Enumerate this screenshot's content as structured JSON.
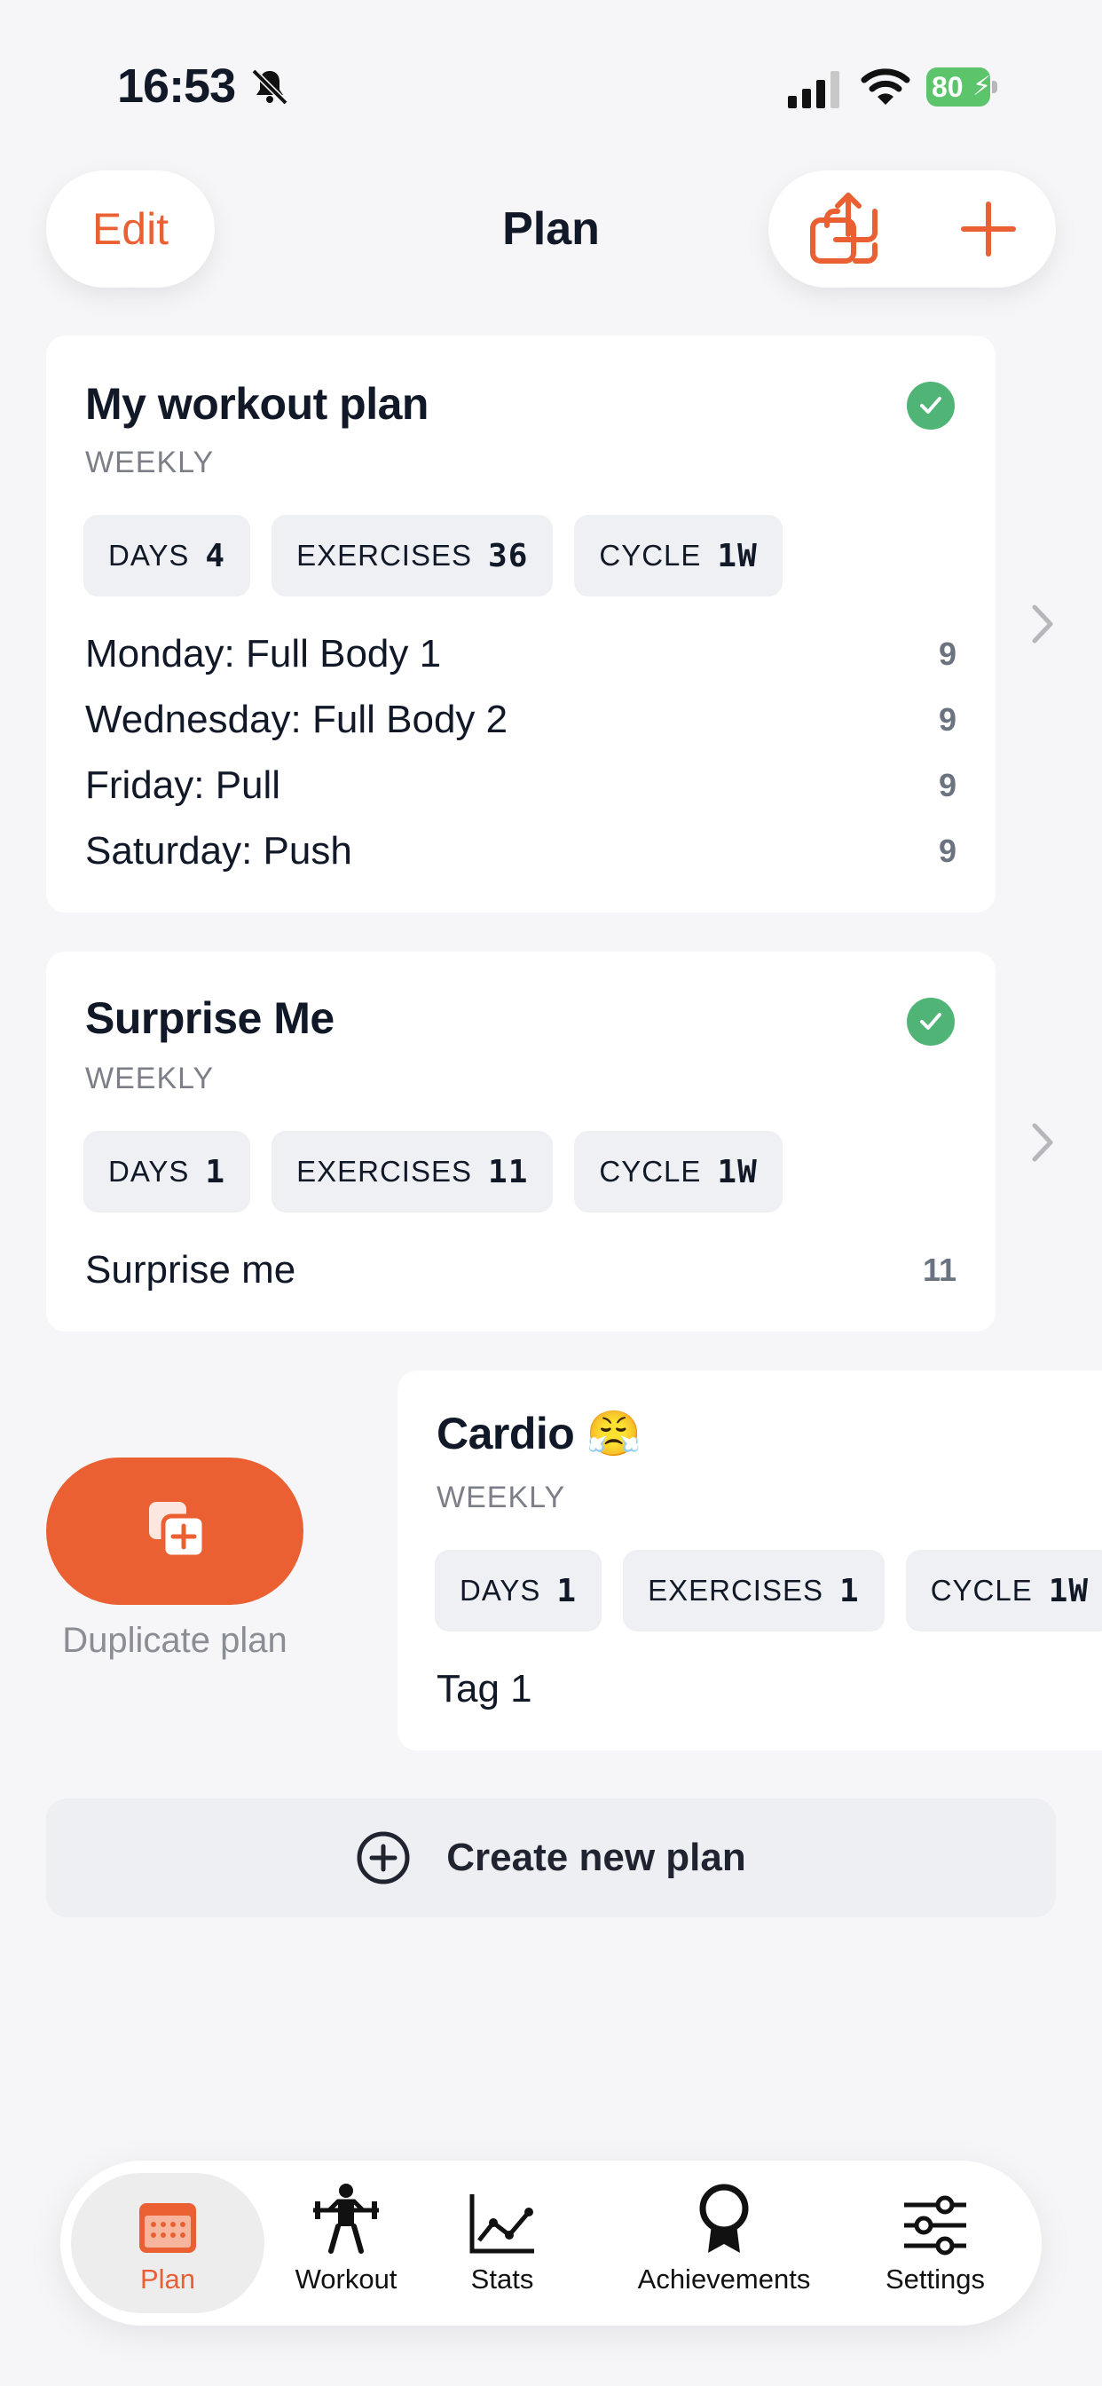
{
  "status_bar": {
    "time": "16:53",
    "battery": "80"
  },
  "header": {
    "edit_label": "Edit",
    "title": "Plan"
  },
  "plans": [
    {
      "title": "My workout plan",
      "subtitle": "WEEKLY",
      "chips": [
        {
          "label": "DAYS",
          "value": "4"
        },
        {
          "label": "EXERCISES",
          "value": "36"
        },
        {
          "label": "CYCLE",
          "value": "1W"
        }
      ],
      "days": [
        {
          "name": "Monday: Full Body 1",
          "count": "9"
        },
        {
          "name": "Wednesday: Full Body 2",
          "count": "9"
        },
        {
          "name": "Friday: Pull",
          "count": "9"
        },
        {
          "name": "Saturday: Push",
          "count": "9"
        }
      ]
    },
    {
      "title": "Surprise Me",
      "subtitle": "WEEKLY",
      "chips": [
        {
          "label": "DAYS",
          "value": "1"
        },
        {
          "label": "EXERCISES",
          "value": "11"
        },
        {
          "label": "CYCLE",
          "value": "1W"
        }
      ],
      "days": [
        {
          "name": "Surprise me",
          "count": "11"
        }
      ]
    },
    {
      "title": "Cardio 😤",
      "subtitle": "WEEKLY",
      "chips": [
        {
          "label": "DAYS",
          "value": "1"
        },
        {
          "label": "EXERCISES",
          "value": "1"
        },
        {
          "label": "CYCLE",
          "value": "1W"
        }
      ],
      "days": [
        {
          "name": "Tag 1",
          "count": ""
        }
      ]
    }
  ],
  "swipe_action": {
    "label": "Duplicate plan"
  },
  "create_button": {
    "label": "Create new plan"
  },
  "tabs": [
    {
      "label": "Plan",
      "icon": "calendar-icon"
    },
    {
      "label": "Workout",
      "icon": "weightlifter-icon"
    },
    {
      "label": "Stats",
      "icon": "line-chart-icon"
    },
    {
      "label": "Achievements",
      "icon": "award-icon"
    },
    {
      "label": "Settings",
      "icon": "sliders-icon"
    }
  ],
  "colors": {
    "accent": "#ea6033",
    "check": "#4fb475",
    "background": "#f6f6f8"
  }
}
